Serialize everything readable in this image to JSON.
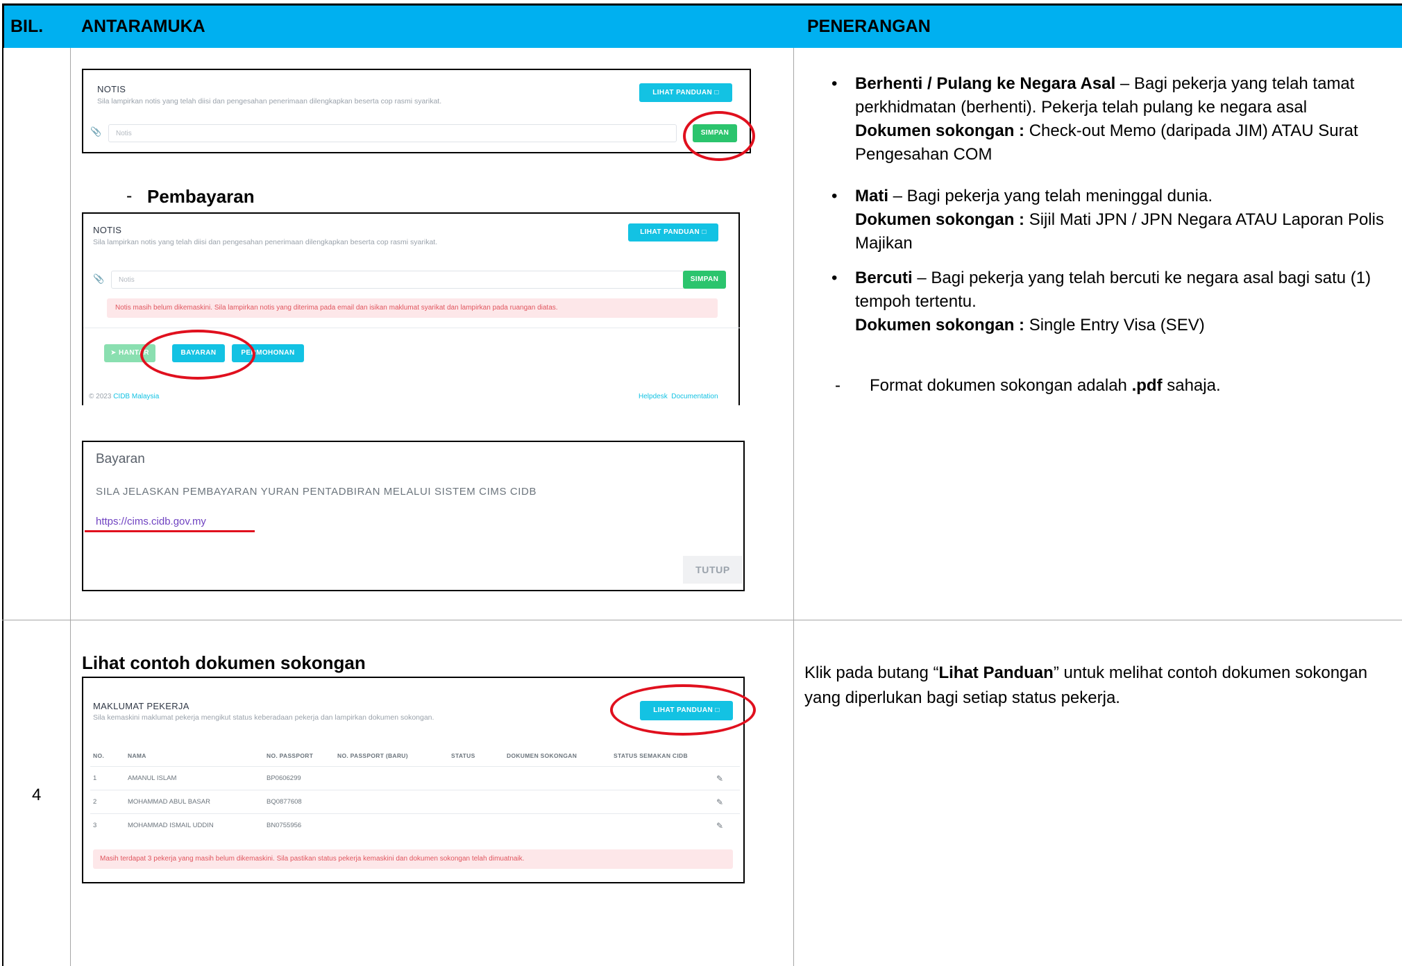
{
  "header": {
    "col_bil": "BIL.",
    "col_antaramuka": "ANTARAMUKA",
    "col_penerangan": "PENERANGAN"
  },
  "row3": {
    "notis1": {
      "title": "NOTIS",
      "subtitle": "Sila lampirkan notis yang telah diisi dan pengesahan penerimaan dilengkapkan beserta cop rasmi syarikat.",
      "button_panduan": "LIHAT PANDUAN",
      "input_placeholder": "Notis",
      "button_simpan": "SIMPAN"
    },
    "pembayaran_dash": "-",
    "pembayaran_heading": "Pembayaran",
    "notis2": {
      "title": "NOTIS",
      "subtitle": "Sila lampirkan notis yang telah diisi dan pengesahan penerimaan dilengkapkan beserta cop rasmi syarikat.",
      "button_panduan": "LIHAT PANDUAN",
      "input_placeholder": "Notis",
      "button_simpan": "SIMPAN",
      "alert": "Notis masih belum dikemaskini. Sila lampirkan notis yang diterima pada email dan isikan maklumat syarikat dan lampirkan pada ruangan diatas.",
      "button_hantar": "HANTAR",
      "button_bayaran": "BAYARAN",
      "button_permohonan": "PERMOHONAN",
      "footer_copy": "© 2023",
      "footer_brand": "CIDB Malaysia",
      "footer_helpdesk": "Helpdesk",
      "footer_docs": "Documentation"
    },
    "bayaran": {
      "title": "Bayaran",
      "message": "SILA JELASKAN PEMBAYARAN YURAN PENTADBIRAN MELALUI SISTEM CIMS CIDB",
      "link": "https://cims.cidb.gov.my",
      "button_tutup": "TUTUP"
    },
    "desc": {
      "b1_bold": "Berhenti / Pulang ke Negara Asal",
      "b1_text": " – Bagi pekerja yang telah tamat perkhidmatan (berhenti). Pekerja telah pulang ke negara asal",
      "b1_doc_label": "Dokumen sokongan :",
      "b1_doc_text": " Check-out Memo (daripada JIM) ATAU Surat Pengesahan COM",
      "b2_bold": "Mati",
      "b2_text": " – Bagi pekerja yang telah meninggal dunia.",
      "b2_doc_label": "Dokumen sokongan :",
      "b2_doc_text": " Sijil Mati JPN / JPN Negara ATAU Laporan Polis Majikan",
      "b3_bold": "Bercuti",
      "b3_text": " – Bagi pekerja yang telah bercuti ke negara asal bagi satu (1) tempoh tertentu.",
      "b3_doc_label": "Dokumen sokongan :",
      "b3_doc_text": " Single Entry Visa (SEV)",
      "format_dash": "-",
      "format_text": "Format dokumen sokongan adalah ",
      "format_bold": ".pdf",
      "format_tail": " sahaja."
    }
  },
  "row4": {
    "bil": "4",
    "heading": "Lihat contoh dokumen sokongan",
    "panel": {
      "title": "MAKLUMAT PEKERJA",
      "subtitle": "Sila kemaskini maklumat pekerja mengikut status keberadaan pekerja dan lampirkan dokumen sokongan.",
      "button_panduan": "LIHAT PANDUAN",
      "columns": [
        "NO.",
        "NAMA",
        "NO. PASSPORT",
        "NO. PASSPORT (BARU)",
        "STATUS",
        "DOKUMEN SOKONGAN",
        "STATUS SEMAKAN CIDB"
      ],
      "rows": [
        {
          "no": "1",
          "nama": "AMANUL ISLAM",
          "passport": "BP0606299"
        },
        {
          "no": "2",
          "nama": "MOHAMMAD ABUL BASAR",
          "passport": "BQ0877608"
        },
        {
          "no": "3",
          "nama": "MOHAMMAD ISMAIL UDDIN",
          "passport": "BN0755956"
        }
      ],
      "alert": "Masih terdapat 3 pekerja yang masih belum dikemaskini. Sila pastikan status pekerja kemaskini dan dokumen sokongan telah dimuatnaik."
    },
    "desc_pre": "Klik pada butang “",
    "desc_bold": "Lihat Panduan",
    "desc_post": "” untuk melihat contoh dokumen sokongan yang diperlukan bagi setiap status pekerja."
  },
  "colors": {
    "header_bg": "#00b0f0",
    "cyan_button": "#13c2e3",
    "green_button": "#2bc46d",
    "annotation_red": "#e0101e",
    "alert_bg": "#fde7e9"
  }
}
